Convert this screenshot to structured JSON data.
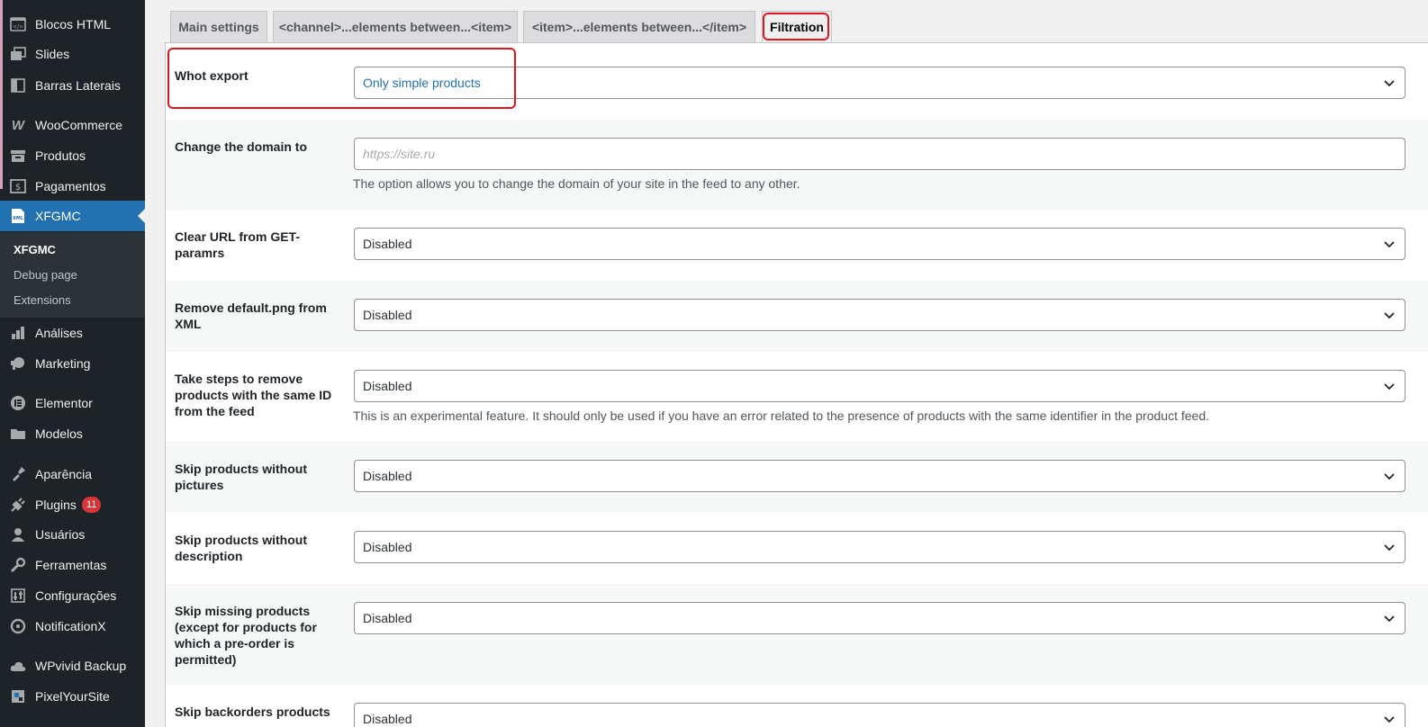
{
  "sidebar": {
    "items": [
      {
        "label": "Blocos HTML",
        "icon": "html-block-icon"
      },
      {
        "label": "Slides",
        "icon": "slides-icon"
      },
      {
        "label": "Barras Laterais",
        "icon": "sidebar-icon"
      },
      {
        "label": "WooCommerce",
        "icon": "woocommerce-icon"
      },
      {
        "label": "Produtos",
        "icon": "products-icon"
      },
      {
        "label": "Pagamentos",
        "icon": "payments-icon"
      },
      {
        "label": "XFGMC",
        "icon": "xml-icon"
      },
      {
        "label": "Análises",
        "icon": "analytics-icon"
      },
      {
        "label": "Marketing",
        "icon": "marketing-icon"
      },
      {
        "label": "Elementor",
        "icon": "elementor-icon"
      },
      {
        "label": "Modelos",
        "icon": "folder-icon"
      },
      {
        "label": "Aparência",
        "icon": "appearance-icon"
      },
      {
        "label": "Plugins",
        "icon": "plugins-icon",
        "badge": "11"
      },
      {
        "label": "Usuários",
        "icon": "users-icon"
      },
      {
        "label": "Ferramentas",
        "icon": "tools-icon"
      },
      {
        "label": "Configurações",
        "icon": "settings-icon"
      },
      {
        "label": "NotificationX",
        "icon": "notificationx-icon"
      },
      {
        "label": "WPvivid Backup",
        "icon": "cloud-icon"
      },
      {
        "label": "PixelYourSite",
        "icon": "pixelyoursite-icon"
      }
    ],
    "submenu": [
      {
        "label": "XFGMC"
      },
      {
        "label": "Debug page"
      },
      {
        "label": "Extensions"
      }
    ],
    "accent": "#2271b1"
  },
  "tabs": [
    {
      "label": "Main settings"
    },
    {
      "label": "<channel>...elements between...<item>"
    },
    {
      "label": "<item>...elements between...</item>"
    },
    {
      "label": "Filtration"
    }
  ],
  "rows": [
    {
      "label": "Whot export",
      "value": "Only simple products"
    },
    {
      "label": "Change the domain to",
      "placeholder": "https://site.ru",
      "description": "The option allows you to change the domain of your site in the feed to any other."
    },
    {
      "label": "Clear URL from GET-paramrs",
      "value": "Disabled"
    },
    {
      "label": "Remove default.png from XML",
      "value": "Disabled"
    },
    {
      "label": "Take steps to remove products with the same ID from the feed",
      "value": "Disabled",
      "description": "This is an experimental feature. It should only be used if you have an error related to the presence of products with the same identifier in the product feed."
    },
    {
      "label": "Skip products without pictures",
      "value": "Disabled"
    },
    {
      "label": "Skip products without description",
      "value": "Disabled"
    },
    {
      "label": "Skip missing products (except for products for which a pre-order is permitted)",
      "value": "Disabled"
    },
    {
      "label": "Skip backorders products",
      "value": "Disabled"
    }
  ],
  "colors": {
    "highlight": "#e0141e",
    "link": "#2271b1",
    "badge": "#d63638"
  }
}
